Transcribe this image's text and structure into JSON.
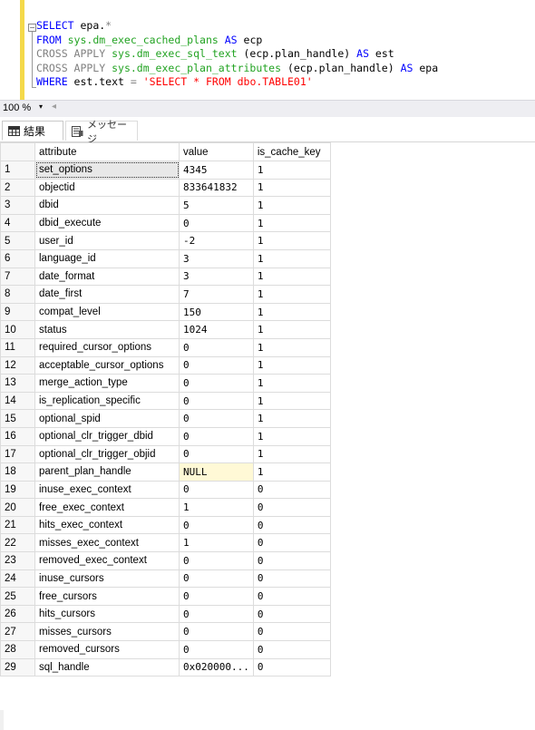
{
  "editor": {
    "fold_symbol": "−",
    "lines": [
      [
        {
          "t": "SELECT",
          "c": "kw"
        },
        {
          "t": " epa.",
          "c": ""
        },
        {
          "t": "*",
          "c": "gr"
        }
      ],
      [
        {
          "t": "FROM ",
          "c": "kw"
        },
        {
          "t": "sys.dm_exec_cached_plans",
          "c": "fn"
        },
        {
          "t": " ",
          "c": ""
        },
        {
          "t": "AS",
          "c": "kw"
        },
        {
          "t": " ecp",
          "c": ""
        }
      ],
      [
        {
          "t": "CROSS APPLY ",
          "c": "gr"
        },
        {
          "t": "sys.dm_exec_sql_text",
          "c": "fn"
        },
        {
          "t": " (ecp.plan_handle) ",
          "c": ""
        },
        {
          "t": "AS",
          "c": "kw"
        },
        {
          "t": " est",
          "c": ""
        }
      ],
      [
        {
          "t": "CROSS APPLY ",
          "c": "gr"
        },
        {
          "t": "sys.dm_exec_plan_attributes",
          "c": "fn"
        },
        {
          "t": " (ecp.plan_handle) ",
          "c": ""
        },
        {
          "t": "AS",
          "c": "kw"
        },
        {
          "t": " epa",
          "c": ""
        }
      ],
      [
        {
          "t": "WHERE",
          "c": "kw"
        },
        {
          "t": " est.text ",
          "c": ""
        },
        {
          "t": "=",
          "c": "gr"
        },
        {
          "t": " ",
          "c": ""
        },
        {
          "t": "'SELECT * FROM dbo.TABLE01'",
          "c": "str"
        }
      ]
    ]
  },
  "zoom": {
    "value": "100 %",
    "caret": "▾",
    "scroll_left": "◂"
  },
  "tabs": {
    "results": "結果",
    "messages": "メッセージ"
  },
  "grid": {
    "columns": [
      "attribute",
      "value",
      "is_cache_key"
    ],
    "rows": [
      [
        "1",
        "set_options",
        "4345",
        "1"
      ],
      [
        "2",
        "objectid",
        "833641832",
        "1"
      ],
      [
        "3",
        "dbid",
        "5",
        "1"
      ],
      [
        "4",
        "dbid_execute",
        "0",
        "1"
      ],
      [
        "5",
        "user_id",
        "-2",
        "1"
      ],
      [
        "6",
        "language_id",
        "3",
        "1"
      ],
      [
        "7",
        "date_format",
        "3",
        "1"
      ],
      [
        "8",
        "date_first",
        "7",
        "1"
      ],
      [
        "9",
        "compat_level",
        "150",
        "1"
      ],
      [
        "10",
        "status",
        "1024",
        "1"
      ],
      [
        "11",
        "required_cursor_options",
        "0",
        "1"
      ],
      [
        "12",
        "acceptable_cursor_options",
        "0",
        "1"
      ],
      [
        "13",
        "merge_action_type",
        "0",
        "1"
      ],
      [
        "14",
        "is_replication_specific",
        "0",
        "1"
      ],
      [
        "15",
        "optional_spid",
        "0",
        "1"
      ],
      [
        "16",
        "optional_clr_trigger_dbid",
        "0",
        "1"
      ],
      [
        "17",
        "optional_clr_trigger_objid",
        "0",
        "1"
      ],
      [
        "18",
        "parent_plan_handle",
        "NULL",
        "1"
      ],
      [
        "19",
        "inuse_exec_context",
        "0",
        "0"
      ],
      [
        "20",
        "free_exec_context",
        "1",
        "0"
      ],
      [
        "21",
        "hits_exec_context",
        "0",
        "0"
      ],
      [
        "22",
        "misses_exec_context",
        "1",
        "0"
      ],
      [
        "23",
        "removed_exec_context",
        "0",
        "0"
      ],
      [
        "24",
        "inuse_cursors",
        "0",
        "0"
      ],
      [
        "25",
        "free_cursors",
        "0",
        "0"
      ],
      [
        "26",
        "hits_cursors",
        "0",
        "0"
      ],
      [
        "27",
        "misses_cursors",
        "0",
        "0"
      ],
      [
        "28",
        "removed_cursors",
        "0",
        "0"
      ],
      [
        "29",
        "sql_handle",
        "0x020000...",
        "0"
      ]
    ],
    "selected_row": 0,
    "null_highlight_row": 17
  },
  "colors": {
    "keyword": "#0000ff",
    "function": "#22a322",
    "string": "#ff0000",
    "operator": "#808080",
    "margin_bar": "#f4d94a"
  },
  "icons": {
    "results_tab": "grid-icon",
    "messages_tab": "message-icon",
    "fold": "collapse-icon"
  }
}
